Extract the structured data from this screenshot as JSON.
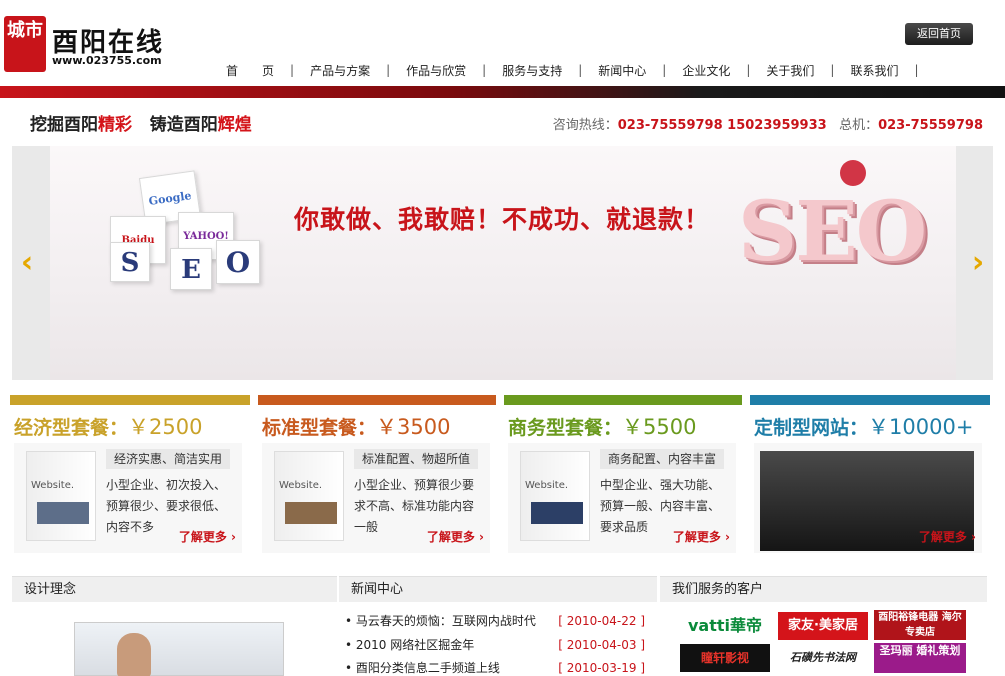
{
  "header": {
    "logo_seal": "城市",
    "logo_name": "酉阳在线",
    "logo_url": "www.023755.com",
    "home_button": "返回首页"
  },
  "nav": [
    {
      "label": "首　　页"
    },
    {
      "label": "产品与方案"
    },
    {
      "label": "作品与欣赏"
    },
    {
      "label": "服务与支持"
    },
    {
      "label": "新闻中心"
    },
    {
      "label": "企业文化"
    },
    {
      "label": "关于我们"
    },
    {
      "label": "联系我们"
    }
  ],
  "slogan": {
    "part1": "挖掘酉阳",
    "part1_red": "精彩",
    "part2": "铸造酉阳",
    "part2_red": "辉煌"
  },
  "hotline": {
    "label": "咨询热线：",
    "numbers": "023-75559798 15023959933",
    "total_label": "总机：",
    "total_number": "023-75559798"
  },
  "banner": {
    "slogan": "你敢做、我敢赔！不成功、就退款！",
    "seo_text": "SEO",
    "cube_letters": [
      "S",
      "E",
      "O"
    ],
    "cube_brands": [
      "Google",
      "Baidu",
      "YAHOO!"
    ],
    "prev_icon": "‹",
    "next_icon": "›"
  },
  "packages": [
    {
      "title": "经济型套餐：",
      "price": "￥2500",
      "color": "#c9a22a",
      "box_label": "Website.",
      "tag": "经济实惠、简洁实用",
      "desc": "小型企业、初次投入、预算很少、要求很低、内容不多",
      "more": "了解更多 ›"
    },
    {
      "title": "标准型套餐：",
      "price": "￥3500",
      "color": "#c85a1e",
      "box_label": "Website.",
      "tag": "标准配置、物超所值",
      "desc": "小型企业、预算很少要求不高、标准功能内容一般",
      "more": "了解更多 ›"
    },
    {
      "title": "商务型套餐：",
      "price": "￥5500",
      "color": "#6a9a1e",
      "box_label": "Website.",
      "tag": "商务配置、内容丰富",
      "desc": "中型企业、强大功能、预算一般、内容丰富、要求品质",
      "more": "了解更多 ›"
    },
    {
      "title": "定制型网站：",
      "price": "￥10000+",
      "color": "#1f7ea8",
      "more": "了解更多 ›"
    }
  ],
  "sections": {
    "design": "设计理念",
    "news": "新闻中心",
    "clients": "我们服务的客户"
  },
  "news": [
    {
      "title": "• 马云春天的烦恼：互联网内战时代",
      "date": "[ 2010-04-22 ]"
    },
    {
      "title": "• 2010 网络社区掘金年",
      "date": "[ 2010-04-03 ]"
    },
    {
      "title": "• 酉阳分类信息二手频道上线",
      "date": "[ 2010-03-19 ]"
    }
  ],
  "clients": [
    {
      "name": "vatti華帝"
    },
    {
      "name": "家友·美家居"
    },
    {
      "name": "酉阳裕锋电器 海尔专卖店"
    },
    {
      "name": "瞳轩影视"
    },
    {
      "name": "石磺先书法网"
    },
    {
      "name": "圣玛丽 婚礼策划"
    }
  ]
}
